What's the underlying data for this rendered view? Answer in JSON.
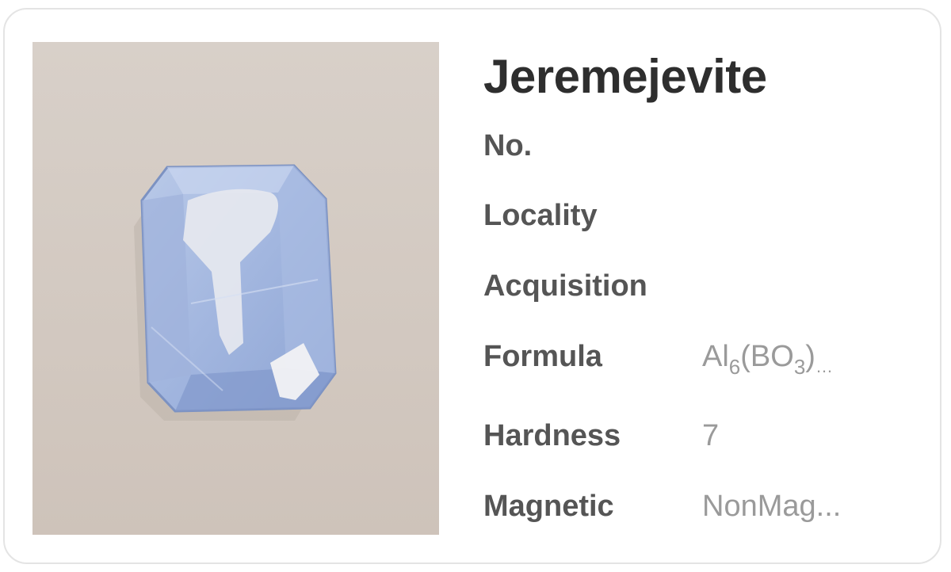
{
  "mineral": {
    "name": "Jeremejevite",
    "photo_icon": "gemstone-photo",
    "fields": [
      {
        "label": "No.",
        "value": ""
      },
      {
        "label": "Locality",
        "value": ""
      },
      {
        "label": "Acquisition",
        "value": ""
      },
      {
        "label": "Formula",
        "value": "Al6(BO3)…",
        "parts": [
          "Al",
          "6",
          "(BO",
          "3",
          ")",
          "…"
        ]
      },
      {
        "label": "Hardness",
        "value": "7"
      },
      {
        "label": "Magnetic",
        "value": "NonMag..."
      }
    ]
  },
  "colors": {
    "title": "#2e2e2e",
    "label": "#555555",
    "value": "#9a9a9a",
    "photo_background": "#d3c9c1",
    "gem": "#a9bde0"
  }
}
